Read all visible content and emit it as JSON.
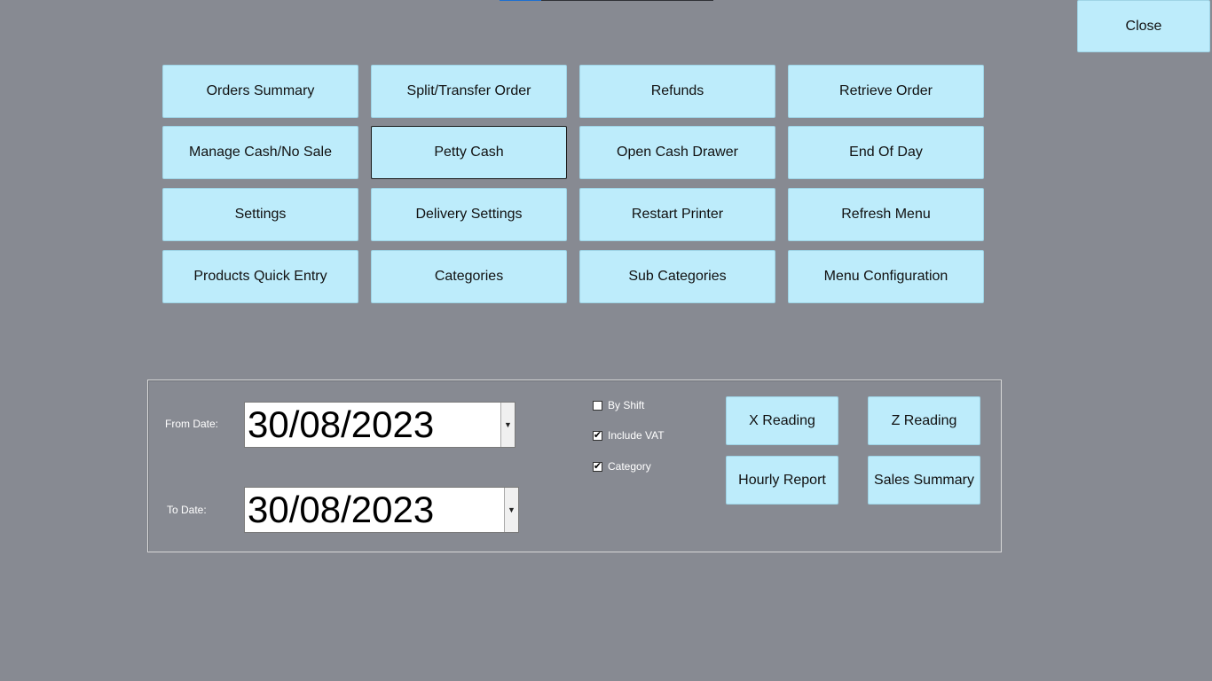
{
  "close_label": "Close",
  "menu_buttons": [
    [
      "Orders Summary",
      "Split/Transfer Order",
      "Refunds",
      "Retrieve Order"
    ],
    [
      "Manage Cash/No Sale",
      "Petty Cash",
      "Open Cash Drawer",
      "End Of Day"
    ],
    [
      "Settings",
      "Delivery Settings",
      "Restart Printer",
      "Refresh Menu"
    ],
    [
      "Products Quick Entry",
      "Categories",
      "Sub Categories",
      "Menu Configuration"
    ]
  ],
  "report": {
    "from_label": "From Date:",
    "from_value": "30/08/2023",
    "to_label": "To Date:",
    "to_value": "30/08/2023",
    "checks": {
      "by_shift": {
        "label": "By Shift",
        "checked": false
      },
      "include_vat": {
        "label": "Include VAT",
        "checked": true
      },
      "category": {
        "label": "Category",
        "checked": true
      }
    },
    "x_reading": "X Reading",
    "z_reading": "Z Reading",
    "hourly_report": "Hourly Report",
    "sales_summary": "Sales Summary"
  },
  "colors": {
    "background": "#878a92",
    "button": "#bdecfb"
  }
}
